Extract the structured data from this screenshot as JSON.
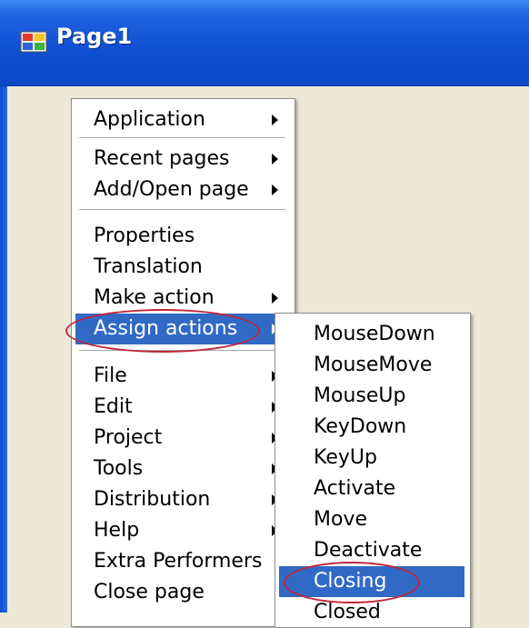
{
  "window": {
    "title": "Page1",
    "icon": "app-window-icon"
  },
  "main_menu": {
    "items": [
      {
        "label": "Application",
        "submenu": true
      },
      {
        "label": "Recent pages",
        "submenu": true
      },
      {
        "label": "Add/Open page",
        "submenu": true
      },
      {
        "label": "Properties",
        "submenu": false
      },
      {
        "label": "Translation",
        "submenu": false
      },
      {
        "label": "Make action",
        "submenu": true
      },
      {
        "label": "Assign actions",
        "submenu": true,
        "selected": true
      },
      {
        "label": "File",
        "submenu": true
      },
      {
        "label": "Edit",
        "submenu": true
      },
      {
        "label": "Project",
        "submenu": true
      },
      {
        "label": "Tools",
        "submenu": true
      },
      {
        "label": "Distribution",
        "submenu": true
      },
      {
        "label": "Help",
        "submenu": true
      },
      {
        "label": "Extra Performers",
        "submenu": false
      },
      {
        "label": "Close page",
        "submenu": false
      }
    ]
  },
  "sub_menu": {
    "items": [
      {
        "label": "MouseDown"
      },
      {
        "label": "MouseMove"
      },
      {
        "label": "MouseUp"
      },
      {
        "label": "KeyDown"
      },
      {
        "label": "KeyUp"
      },
      {
        "label": "Activate"
      },
      {
        "label": "Move"
      },
      {
        "label": "Deactivate"
      },
      {
        "label": "Closing",
        "selected": true
      },
      {
        "label": "Closed"
      }
    ]
  },
  "colors": {
    "titlebar": "#0f4fd2",
    "selection": "#316ac5",
    "annotation_ellipse": "#c0263a",
    "window_background": "#ece9d8"
  }
}
